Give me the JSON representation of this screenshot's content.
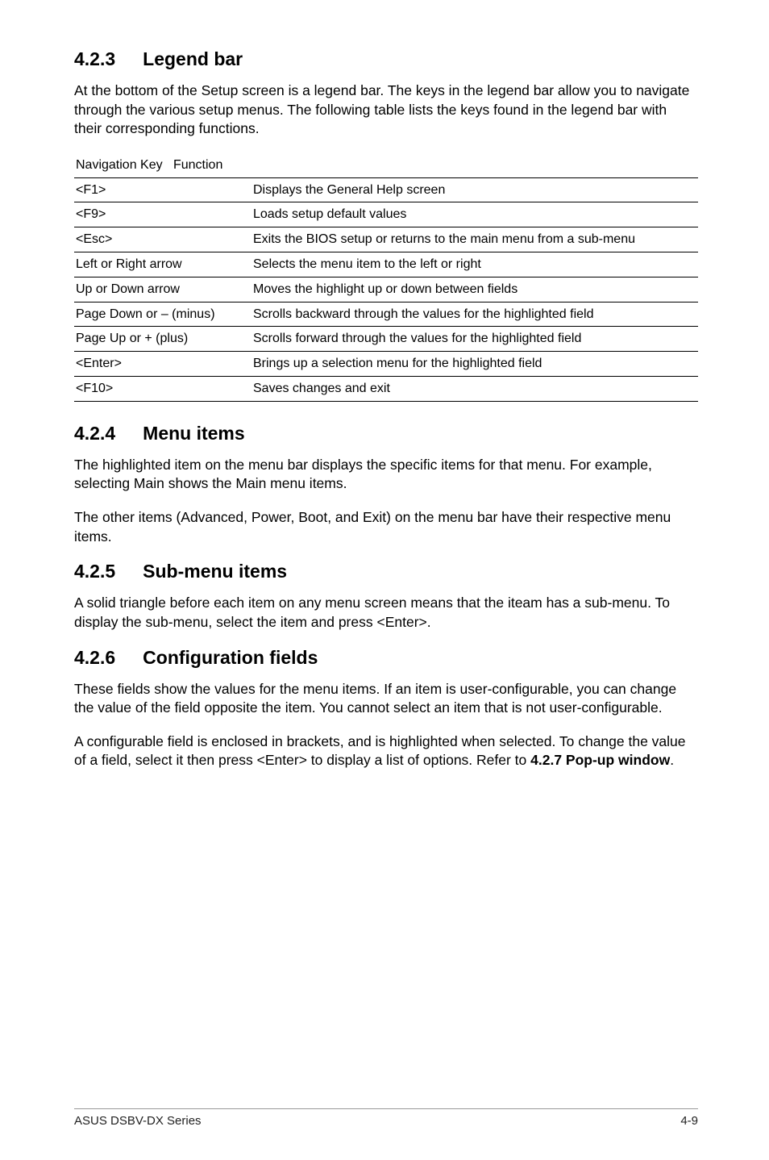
{
  "sections": {
    "s1": {
      "num": "4.2.3",
      "title": "Legend bar"
    },
    "s2": {
      "num": "4.2.4",
      "title": "Menu items"
    },
    "s3": {
      "num": "4.2.5",
      "title": "Sub-menu items"
    },
    "s4": {
      "num": "4.2.6",
      "title": "Configuration fields"
    }
  },
  "paragraphs": {
    "p1": "At the bottom of the Setup screen is a legend bar. The keys in the legend bar allow you to navigate through the various setup menus. The following table lists the keys found in the legend bar with their corresponding functions.",
    "p2": "The highlighted item on the menu bar  displays the specific items for that menu. For example, selecting Main shows the Main menu items.",
    "p3": "The other items (Advanced, Power, Boot, and Exit) on the menu bar have their respective menu items.",
    "p4": "A solid triangle before each item on any menu screen means that the iteam has a sub-menu. To display the sub-menu, select the item and press <Enter>.",
    "p5": "These fields show the values for the menu items. If an item is user-configurable, you can change the value of the field opposite the item. You cannot select an item that is not user-configurable.",
    "p6a": "A configurable field is enclosed in brackets, and is highlighted when selected. To change the value of a field, select it then press <Enter> to display a list of options. Refer to ",
    "p6b": "4.2.7 Pop-up window",
    "p6c": "."
  },
  "table": {
    "head": {
      "col1": "Navigation Key",
      "col2": "Function"
    },
    "rows": [
      {
        "key": "<F1>",
        "fn": "Displays the General Help screen"
      },
      {
        "key": "<F9>",
        "fn": "Loads setup default values"
      },
      {
        "key": "<Esc>",
        "fn": "Exits the BIOS setup or returns to the main menu from a sub-menu"
      },
      {
        "key": "Left or Right arrow",
        "fn": "Selects the menu item to the left or right"
      },
      {
        "key": "Up or Down arrow",
        "fn": "Moves the highlight up or down between fields"
      },
      {
        "key": "Page Down or – (minus)",
        "fn": "Scrolls backward through the values for the highlighted field"
      },
      {
        "key": "Page Up or + (plus)",
        "fn": "Scrolls forward through the values for the highlighted field"
      },
      {
        "key": "<Enter>",
        "fn": "Brings up a selection menu for the highlighted field"
      },
      {
        "key": " <F10>",
        "fn": "Saves changes and exit"
      }
    ]
  },
  "footer": {
    "left": "ASUS DSBV-DX Series",
    "right": "4-9"
  }
}
